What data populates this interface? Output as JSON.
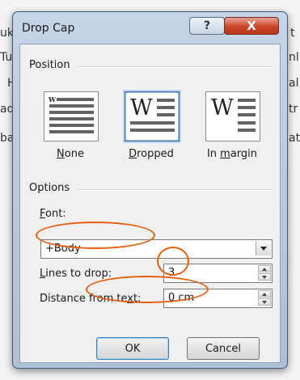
{
  "background_text": {
    "left_fragments": [
      "uk",
      "Tu",
      "H",
      "ad",
      "ba"
    ],
    "right_fragments": [
      "t",
      "nl",
      "al,",
      "tr",
      "at"
    ]
  },
  "dialog": {
    "title": "Drop Cap",
    "help_label": "?",
    "close_label": "X"
  },
  "position": {
    "section_label": "Position",
    "choices": [
      {
        "label_pre": "",
        "label_u": "N",
        "label_post": "one",
        "selected": false
      },
      {
        "label_pre": "",
        "label_u": "D",
        "label_post": "ropped",
        "selected": true
      },
      {
        "label_pre": "In ",
        "label_u": "m",
        "label_post": "argin",
        "selected": false
      }
    ],
    "glyph": "W"
  },
  "options": {
    "section_label": "Options",
    "font_label": {
      "u": "F",
      "rest": "ont:"
    },
    "font_value": "+Body",
    "lines_label": {
      "u": "L",
      "rest": "ines to drop:"
    },
    "lines_value": "3",
    "distance_label": {
      "pre": "Distance from te",
      "u": "x",
      "post": "t:"
    },
    "distance_value": "0 cm"
  },
  "buttons": {
    "ok": "OK",
    "cancel": "Cancel"
  },
  "colors": {
    "annotation": "#e26010",
    "selected_border": "#3f6ea8"
  },
  "annotations": [
    {
      "target": "font-combobox"
    },
    {
      "target": "lines-to-drop"
    },
    {
      "target": "distance-from-text"
    }
  ]
}
